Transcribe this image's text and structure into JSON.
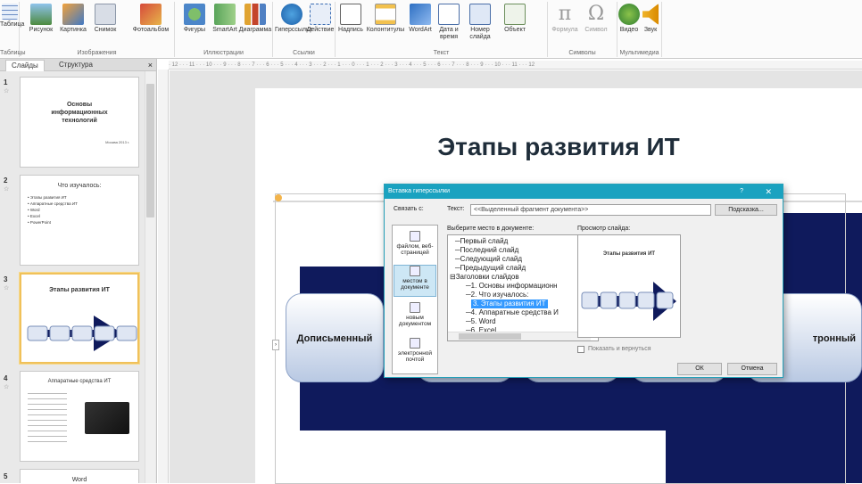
{
  "ribbon": {
    "groups": [
      "Таблицы",
      "Изображения",
      "Иллюстрации",
      "Ссылки",
      "Текст",
      "Символы",
      "Мультимедиа"
    ],
    "buttons": [
      "Таблица",
      "Рисунок",
      "Картинка",
      "Снимок",
      "Фотоальбом",
      "Фигуры",
      "SmartArt",
      "Диаграмма",
      "Гиперссылка",
      "Действие",
      "Надпись",
      "Колонтитулы",
      "WordArt",
      "Дата и время",
      "Номер слайда",
      "Объект",
      "Формула",
      "Символ",
      "Видео",
      "Звук"
    ]
  },
  "panel": {
    "tab_slides": "Слайды",
    "tab_structure": "Структура",
    "close": "×"
  },
  "thumbs": [
    {
      "num": "1",
      "title": "Основы информационных технологий",
      "sub": "Москва 2013 г."
    },
    {
      "num": "2",
      "title": "Что изучалось:",
      "items": [
        "Этапы развития ИТ",
        "Аппаратные средства ИТ",
        "Word",
        "Excel",
        "PowerPoint"
      ]
    },
    {
      "num": "3",
      "title": "Этапы развития ИТ"
    },
    {
      "num": "4",
      "title": "Аппаратные средства ИТ"
    },
    {
      "num": "5",
      "title": "Word"
    }
  ],
  "ruler_text": "· 12 · · · 11 · · · 10 · · · 9 · · · 8 · · · 7 · · · 6 · · · 5 · · · 4 · · · 3 · · · 2 · · · 1 · · · 0 · · · 1 · · · 2 · · · 3 · · · 4 · · · 5 · · · 6 · · · 7 · · · 8 · · · 9 · · · 10 · · · 11 · · · 12",
  "slide": {
    "title": "Этапы развития ИТ",
    "box_left": "Дописьменный",
    "box_right": "тронный"
  },
  "dialog": {
    "title": "Вставка гиперссылки",
    "help": "?",
    "close": "✕",
    "link_label": "Связать с:",
    "text_label": "Текст:",
    "text_value": "<<Выделенный фрагмент документа>>",
    "hint_button": "Подсказка...",
    "side_items": [
      "файлом, веб-страницей",
      "местом в документе",
      "новым документом",
      "электронной почтой"
    ],
    "place_label": "Выберите место в документе:",
    "preview_label": "Просмотр слайда:",
    "tree": [
      "Первый слайд",
      "Последний слайд",
      "Следующий слайд",
      "Предыдущий слайд",
      "Заголовки слайдов",
      "1. Основы информационн",
      "2. Что изучалось:",
      "3. Этапы развития ИТ",
      "4. Аппаратные средства И",
      "5. Word",
      "6. Excel"
    ],
    "preview_title": "Этапы развития ИТ",
    "show_return": "Показать и вернуться",
    "ok": "ОК",
    "cancel": "Отмена"
  },
  "colors": {
    "dialog_header": "#1aa2c0",
    "arrow": "#0f1a5c",
    "selection": "#3399ff"
  }
}
